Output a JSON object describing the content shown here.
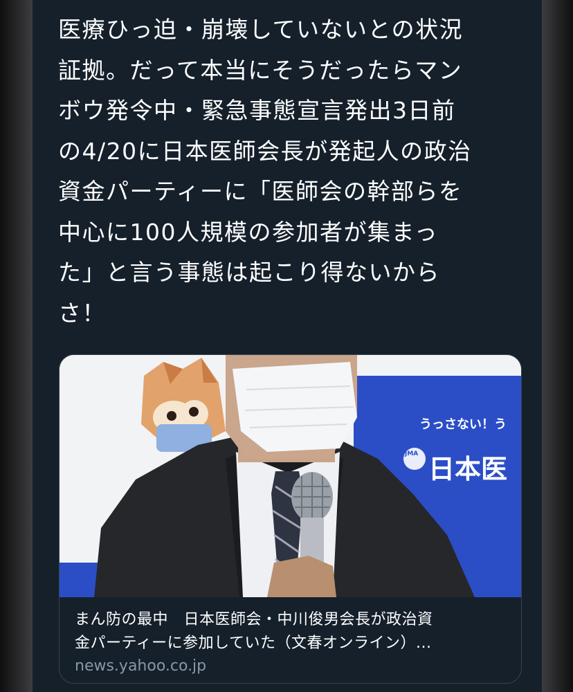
{
  "tweet": {
    "text_lines": [
      "医療ひっ迫・崩壊していないとの状況",
      "証拠。だって本当にそうだったらマン",
      "ボウ発令中・緊急事態宣言発出3日前",
      "の4/20に日本医師会長が発起人の政治",
      "資金パーティーに「医師会の幹部らを",
      "中心に100人規模の参加者が集まっ",
      "た」と言う事態は起こり得ないから",
      "さ！"
    ]
  },
  "link_card": {
    "image": {
      "banner_slogan": "うっさない！う",
      "banner_logo": "JMA",
      "banner_org": "日本医"
    },
    "title_lines": [
      "まん防の最中　日本医師会・中川俊男会長が政治資",
      "金パーティーに参加していた（文春オンライン）..."
    ],
    "domain": "news.yahoo.co.jp"
  },
  "colors": {
    "background": "#15202b",
    "text_primary": "#ffffff",
    "text_secondary": "#8899a6",
    "card_border": "#38444d",
    "banner_blue": "#2b4ec7"
  }
}
